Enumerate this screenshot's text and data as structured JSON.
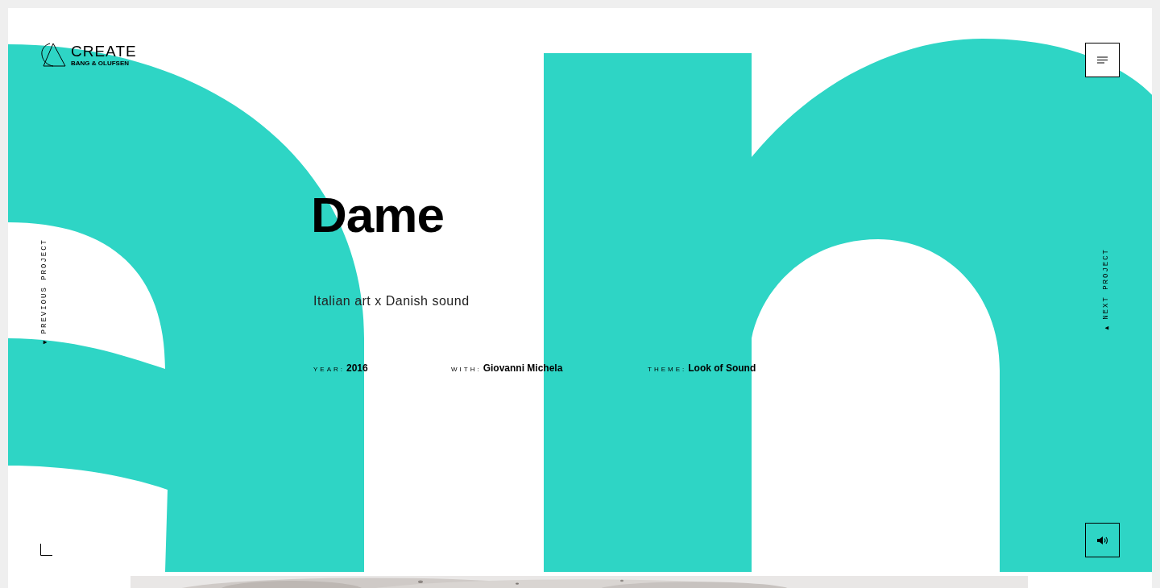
{
  "logo": {
    "title": "CREATE",
    "subtitle": "BANG & OLUFSEN"
  },
  "project": {
    "title": "Dame",
    "tagline": "Italian art x Danish sound",
    "meta": [
      {
        "label": "YEAR:",
        "value": "2016"
      },
      {
        "label": "WITH:",
        "value": "Giovanni Michela"
      },
      {
        "label": "THEME:",
        "value": "Look of Sound"
      }
    ]
  },
  "nav": {
    "previous": "PREVIOUS PROJECT",
    "next": "NEXT PROJECT"
  }
}
